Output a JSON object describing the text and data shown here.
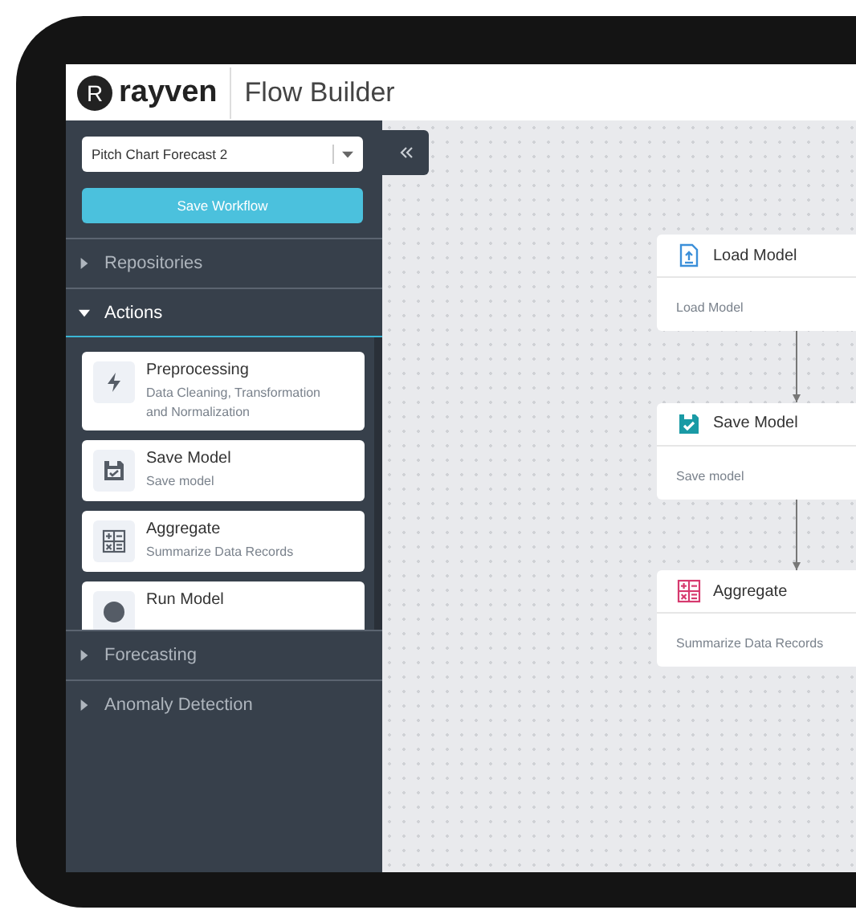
{
  "app": {
    "logo_mark": "R",
    "logo": "rayven",
    "title": "Flow Builder"
  },
  "sidebar": {
    "workflow_select": {
      "value": "Pitch Chart Forecast 2"
    },
    "save_button": "Save Workflow",
    "sections": [
      {
        "label": "Repositories",
        "expanded": false
      },
      {
        "label": "Actions",
        "expanded": true,
        "items": [
          {
            "kind": "preprocess",
            "title": "Preprocessing",
            "description": "Data Cleaning, Transformation and Normalization"
          },
          {
            "kind": "save",
            "title": "Save Model",
            "description": "Save model"
          },
          {
            "kind": "aggregate",
            "title": "Aggregate",
            "description": "Summarize Data Records"
          },
          {
            "kind": "run",
            "title": "Run Model"
          }
        ]
      },
      {
        "label": "Forecasting",
        "expanded": false
      },
      {
        "label": "Anomaly Detection",
        "expanded": false
      }
    ]
  },
  "canvas": {
    "nodes": [
      {
        "kind": "load",
        "title": "Load Model",
        "subtitle": "Load Model"
      },
      {
        "kind": "save",
        "title": "Save Model",
        "subtitle": "Save model"
      },
      {
        "kind": "aggregate",
        "title": "Aggregate",
        "subtitle": "Summarize Data Records"
      }
    ]
  }
}
